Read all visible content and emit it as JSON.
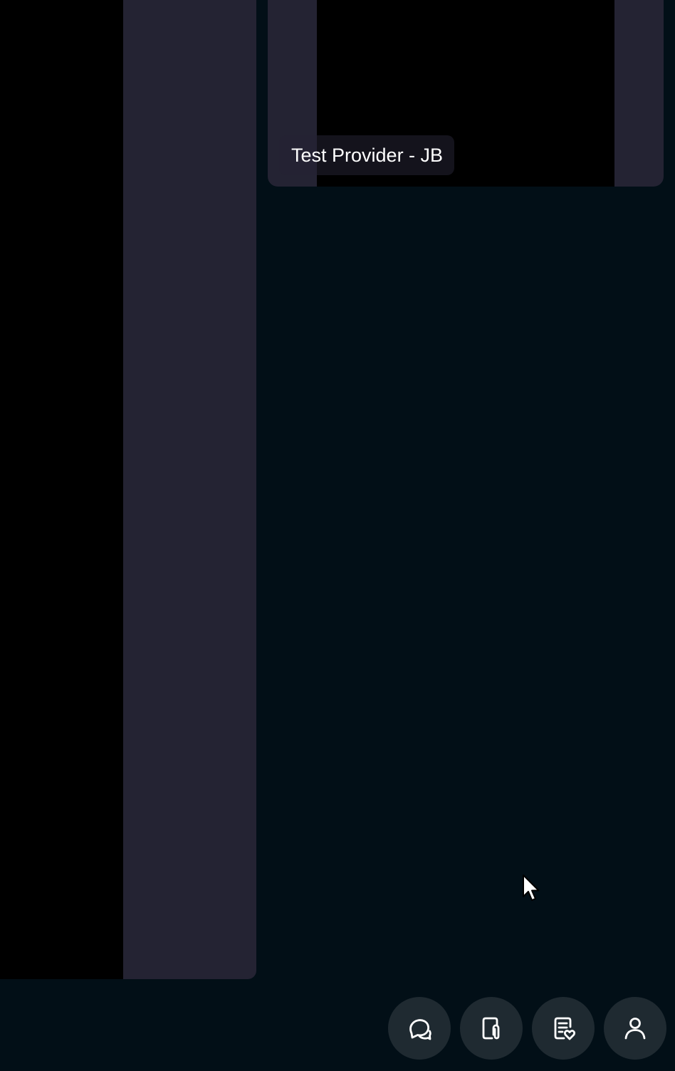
{
  "participants": {
    "secondary": {
      "name": "Test Provider - JB"
    }
  },
  "toolbar": {
    "buttons": [
      {
        "icon": "chat-icon"
      },
      {
        "icon": "file-attachment-icon"
      },
      {
        "icon": "health-document-icon"
      },
      {
        "icon": "user-icon"
      }
    ]
  },
  "colors": {
    "background": "#020f17",
    "tile": "#242333",
    "video": "#000000",
    "button": "#1f2a31",
    "icon": "#ffffff"
  }
}
